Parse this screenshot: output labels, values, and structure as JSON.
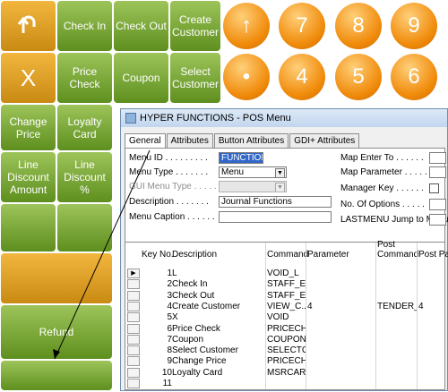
{
  "pos_buttons": {
    "undo_icon": "undo-arrow-icon",
    "check_in": "Check In",
    "check_out": "Check Out",
    "create_customer": "Create\nCustomer",
    "x": "X",
    "price_check": "Price\nCheck",
    "coupon": "Coupon",
    "select_customer": "Select\nCustomer",
    "change_price": "Change\nPrice",
    "loyalty_card": "Loyalty\nCard",
    "line_discount_amount": "Line\nDiscount\nAmount",
    "line_discount_pct": "Line\nDiscount\n%",
    "refund": "Refund"
  },
  "numpad": {
    "row1": [
      "↑",
      "7",
      "8",
      "9"
    ],
    "row2": [
      "•",
      "4",
      "5",
      "6"
    ]
  },
  "window": {
    "title": "HYPER FUNCTIONS - POS Menu",
    "tabs": [
      "General",
      "Attributes",
      "Button Attributes",
      "GDI+ Attributes"
    ],
    "form": {
      "menu_id_label": "Menu ID . . . . . . . . .",
      "menu_id_value": "FUNCTIONS",
      "menu_type_label": "Menu Type . . . . . . .",
      "menu_type_value": "Menu",
      "gui_menu_type_label": "GUI Menu Type . . . . .",
      "gui_menu_type_value": "",
      "description_label": "Description . . . . . . .",
      "description_value": "Journal Functions",
      "menu_caption_label": "Menu Caption . . . . . .",
      "menu_caption_value": "",
      "map_enter_to_label": "Map Enter To . . . . . .",
      "map_parameter_label": "Map Parameter . . . . .",
      "manager_key_label": "Manager Key . . . . . .",
      "no_of_options_label": "No. Of Options . . . . .",
      "lastmenu_label": "LASTMENU Jump to Menu"
    },
    "grid": {
      "headers": {
        "key_no": "Key No.",
        "description": "Description",
        "command": "Command",
        "parameter": "Parameter",
        "post_command": "Post\nCommand",
        "post_para": "Post Para"
      },
      "rows": [
        {
          "key": "1",
          "desc": "L",
          "cmd": "VOID_L",
          "param": "",
          "post_cmd": "",
          "post_para": ""
        },
        {
          "key": "2",
          "desc": "Check In",
          "cmd": "STAFF_E...",
          "param": "",
          "post_cmd": "",
          "post_para": ""
        },
        {
          "key": "3",
          "desc": "Check Out",
          "cmd": "STAFF_E...",
          "param": "",
          "post_cmd": "",
          "post_para": ""
        },
        {
          "key": "4",
          "desc": "Create Customer",
          "cmd": "VIEW_C...",
          "param": "4",
          "post_cmd": "TENDER_K",
          "post_para": "4"
        },
        {
          "key": "5",
          "desc": "X",
          "cmd": "VOID",
          "param": "",
          "post_cmd": "",
          "post_para": ""
        },
        {
          "key": "6",
          "desc": "Price Check",
          "cmd": "PRICECHK",
          "param": "",
          "post_cmd": "",
          "post_para": ""
        },
        {
          "key": "7",
          "desc": "Coupon",
          "cmd": "COUPON",
          "param": "",
          "post_cmd": "",
          "post_para": ""
        },
        {
          "key": "8",
          "desc": "Select Customer",
          "cmd": "SELECTC...",
          "param": "",
          "post_cmd": "",
          "post_para": ""
        },
        {
          "key": "9",
          "desc": "Change Price",
          "cmd": "PRICECH",
          "param": "",
          "post_cmd": "",
          "post_para": ""
        },
        {
          "key": "10",
          "desc": "Loyalty Card",
          "cmd": "MSRCARD",
          "param": "",
          "post_cmd": "",
          "post_para": ""
        },
        {
          "key": "11",
          "desc": "",
          "cmd": "",
          "param": "",
          "post_cmd": "",
          "post_para": ""
        }
      ]
    }
  }
}
